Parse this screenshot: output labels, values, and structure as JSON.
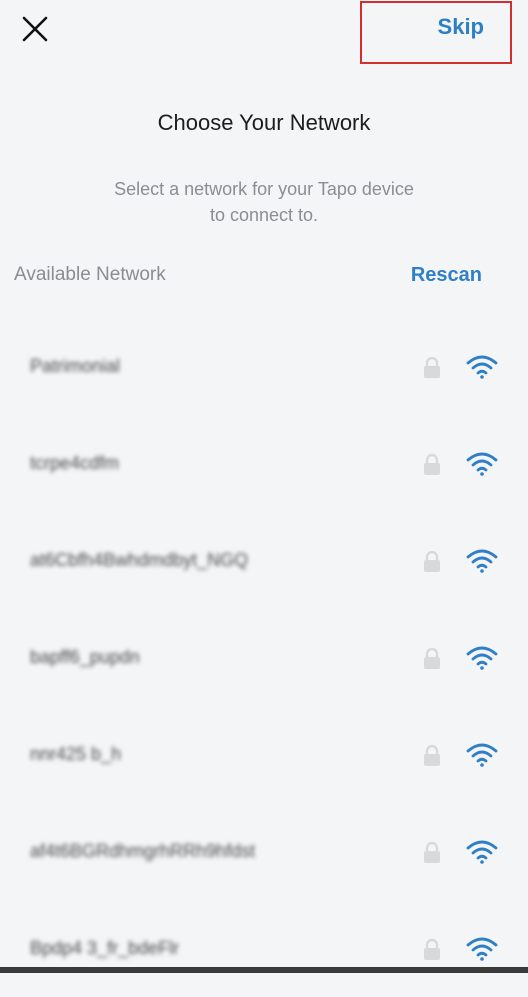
{
  "header": {
    "close_icon": "close-icon",
    "skip_label": "Skip"
  },
  "title": "Choose Your Network",
  "subtitle_line1": "Select a network for your Tapo device",
  "subtitle_line2": "to connect to.",
  "section": {
    "label": "Available Network",
    "rescan_label": "Rescan"
  },
  "networks": [
    {
      "name": "Patrimonial",
      "locked": true,
      "icon": "wifi-icon"
    },
    {
      "name": "tcrpe4cdfm",
      "locked": true,
      "icon": "wifi-icon"
    },
    {
      "name": "at6Cbfh4Bwhdmdbyt_NGQ",
      "locked": true,
      "icon": "wifi-icon"
    },
    {
      "name": "bapff6_pupdn",
      "locked": true,
      "icon": "wifi-icon"
    },
    {
      "name": "nnr425 b_h",
      "locked": true,
      "icon": "wifi-icon"
    },
    {
      "name": "af4t6BGRdhmgrhRRh9hfdst",
      "locked": true,
      "icon": "wifi-icon"
    },
    {
      "name": "Bpdp4 3_fr_bdeFlr",
      "locked": true,
      "icon": "wifi-icon"
    }
  ],
  "colors": {
    "accent": "#2f7fc6",
    "highlight_border": "#d32f2f",
    "background": "#f4f5f7"
  }
}
